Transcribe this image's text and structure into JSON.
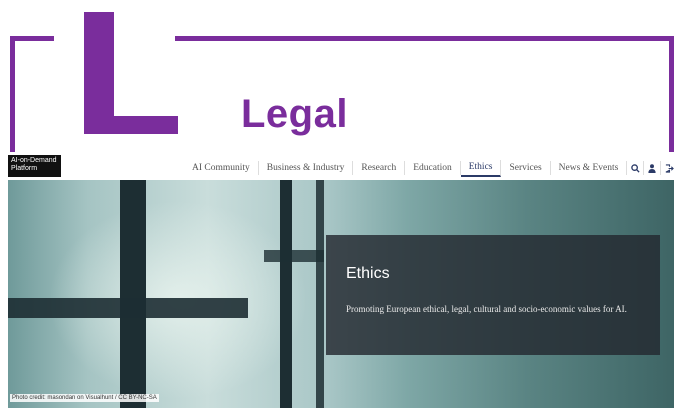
{
  "slide": {
    "title": "Legal"
  },
  "site": {
    "logo": {
      "line1": "AI-on-Demand",
      "line2": "Platform"
    },
    "nav": [
      {
        "label": "AI Community"
      },
      {
        "label": "Business & Industry"
      },
      {
        "label": "Research"
      },
      {
        "label": "Education"
      },
      {
        "label": "Ethics",
        "active": true
      },
      {
        "label": "Services"
      },
      {
        "label": "News & Events"
      }
    ],
    "icons": [
      "search-icon",
      "user-icon",
      "logout-icon",
      "menu-icon"
    ],
    "hero": {
      "heading": "Ethics",
      "description": "Promoting European ethical, legal, cultural and socio-economic values for AI.",
      "credit": "Photo credit: masondan on Visualhunt / CC BY-NC-SA"
    }
  },
  "colors": {
    "accent": "#7a2d9c",
    "nav_active": "#2b3a67",
    "overlay": "#23282f"
  }
}
